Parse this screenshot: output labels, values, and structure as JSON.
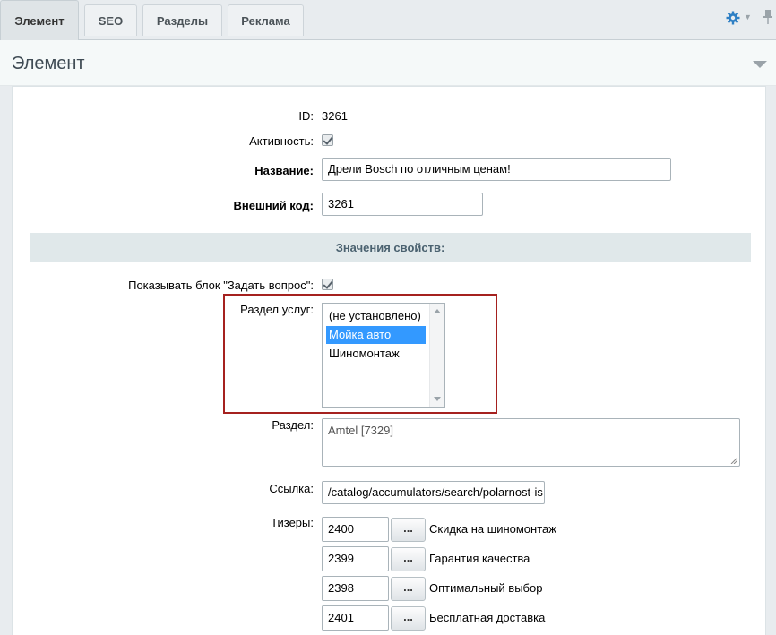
{
  "tabs": [
    {
      "label": "Элемент",
      "active": true
    },
    {
      "label": "SEO",
      "active": false
    },
    {
      "label": "Разделы",
      "active": false
    },
    {
      "label": "Реклама",
      "active": false
    }
  ],
  "panel": {
    "title": "Элемент"
  },
  "fields": {
    "id_label": "ID:",
    "id_value": "3261",
    "active_label": "Активность:",
    "name_label": "Название:",
    "name_value": "Дрели Bosch по отличным ценам!",
    "xml_label": "Внешний код:",
    "xml_value": "3261"
  },
  "properties": {
    "section_title": "Значения свойств:",
    "ask_label": "Показывать блок \"Задать вопрос\":",
    "services_label": "Раздел услуг:",
    "services_options": [
      "(не установлено)",
      "Мойка авто",
      "Шиномонтаж"
    ],
    "services_selected": "Мойка авто",
    "section_label": "Раздел:",
    "section_value": "Amtel [7329]",
    "link_label": "Ссылка:",
    "link_value": "/catalog/accumulators/search/polarnost-is",
    "teasers_label": "Тизеры:",
    "teasers": [
      {
        "id": "2400",
        "button": "...",
        "name": "Скидка на шиномонтаж"
      },
      {
        "id": "2399",
        "button": "...",
        "name": "Гарантия качества"
      },
      {
        "id": "2398",
        "button": "...",
        "name": "Оптимальный выбор"
      },
      {
        "id": "2401",
        "button": "...",
        "name": "Бесплатная доставка"
      }
    ]
  },
  "colors": {
    "accent": "#3399ff",
    "highlight_border": "#a5211f",
    "section_bar": "#e0e8ea"
  }
}
